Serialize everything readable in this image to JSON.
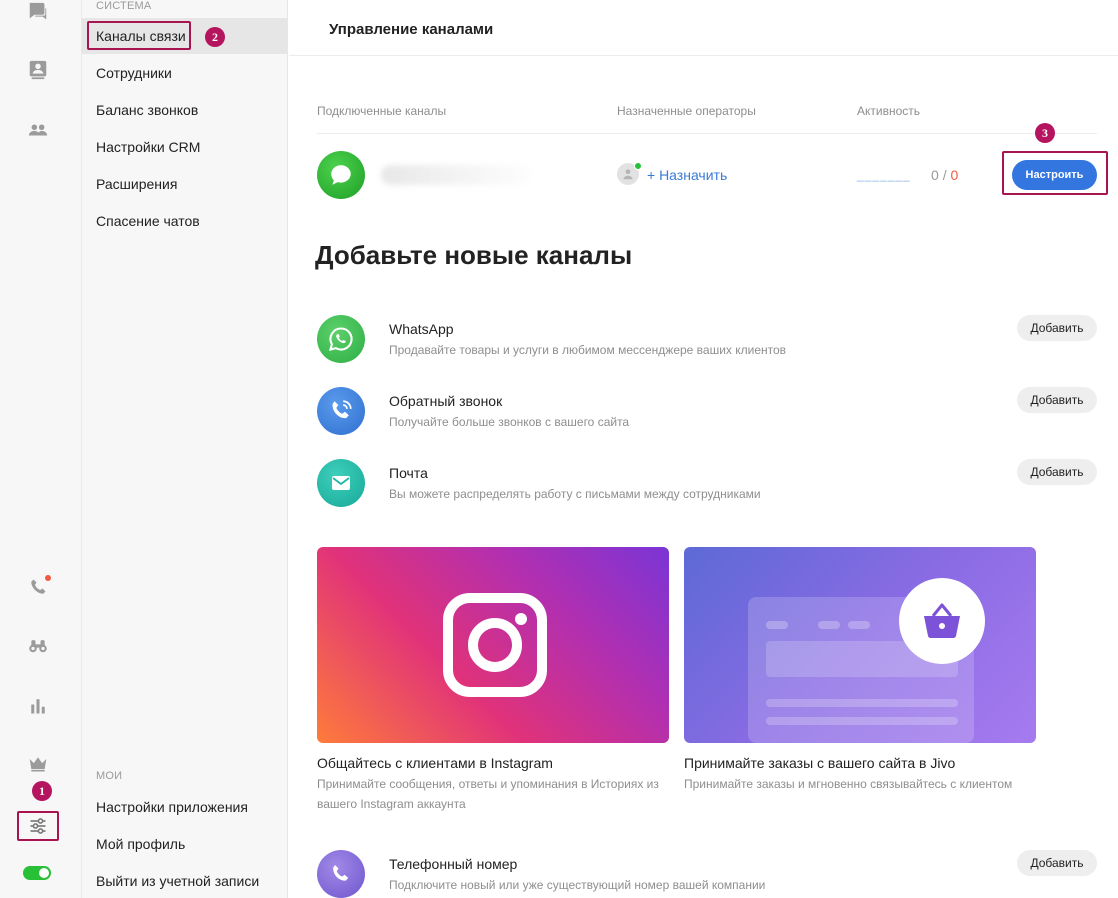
{
  "rail": {
    "icons": [
      "chat-icon",
      "contacts-icon",
      "team-icon",
      "phone-icon",
      "binoculars-icon",
      "reports-icon",
      "crown-icon",
      "settings-sliders-icon"
    ],
    "toggle_on": true,
    "marker_1": "1"
  },
  "menu": {
    "section_system": "СИСТЕМА",
    "items": [
      {
        "label": "Каналы связи",
        "active": true
      },
      {
        "label": "Сотрудники"
      },
      {
        "label": "Баланс звонков"
      },
      {
        "label": "Настройки CRM"
      },
      {
        "label": "Расширения"
      },
      {
        "label": "Спасение чатов"
      }
    ],
    "section_mine": "МОИ",
    "mine_items": [
      {
        "label": "Настройки приложения"
      },
      {
        "label": "Мой профиль"
      },
      {
        "label": "Выйти из учетной записи"
      }
    ],
    "marker_2": "2"
  },
  "header": {
    "title": "Управление каналами"
  },
  "channels_table": {
    "columns": [
      "Подключенные каналы",
      "Назначенные операторы",
      "Активность"
    ],
    "row": {
      "assign_label": "+ Назначить",
      "activity_dashes": "_______",
      "activity_done": "0",
      "activity_sep": "/",
      "activity_total": "0",
      "configure_label": "Настроить"
    },
    "marker_3": "3"
  },
  "add_section": {
    "heading": "Добавьте новые каналы",
    "add_label": "Добавить",
    "options": [
      {
        "title": "WhatsApp",
        "desc": "Продавайте товары и услуги в любимом мессенджере ваших клиентов",
        "icon": "whatsapp-icon",
        "color": "#35c14a"
      },
      {
        "title": "Обратный звонок",
        "desc": "Получайте больше звонков с вашего сайта",
        "icon": "callback-icon",
        "color": "#3a7fd9"
      },
      {
        "title": "Почта",
        "desc": "Вы можете распределять работу с письмами между сотрудниками",
        "icon": "mail-icon",
        "color": "#1fb6a6"
      }
    ],
    "promos": [
      {
        "title": "Общайтесь с клиентами в Instagram",
        "desc": "Принимайте сообщения, ответы и упоминания в Историях из вашего Instagram аккаунта",
        "icon": "instagram-icon"
      },
      {
        "title": "Принимайте заказы с вашего сайта в Jivo",
        "desc": "Принимайте заказы и мгновенно связывайтесь с клиентом",
        "icon": "basket-icon"
      }
    ],
    "phone_option": {
      "title": "Телефонный номер",
      "desc": "Подключите новый или уже существующий номер вашей компании",
      "icon": "phone-icon",
      "color": "#7a5cd6"
    }
  }
}
